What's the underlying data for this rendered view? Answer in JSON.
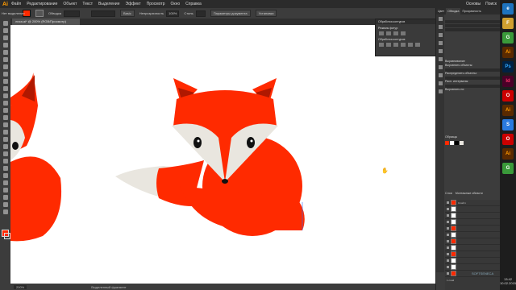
{
  "app": {
    "logo": "Ai"
  },
  "menu": [
    "Файл",
    "Редактирование",
    "Объект",
    "Текст",
    "Выделение",
    "Эффект",
    "Просмотр",
    "Окно",
    "Справка"
  ],
  "window_right": [
    "Основы",
    "Поиск"
  ],
  "control_bar": {
    "label_left": "Нет выделения",
    "stroke_label": "Обводка",
    "opacity_label": "Непрозрачность",
    "opacity_value": "100%",
    "style_label": "Стиль",
    "brush": "Basic",
    "doc_settings_btn": "Параметры документа",
    "prefs_btn": "Установки",
    "fill_color": "#ff2a00"
  },
  "doc_tab": {
    "title": "лиса.ai* @ 200% (RGB/Просмотр)"
  },
  "float_panel": {
    "title": "Обработка контуров",
    "shape_modes": "Режимы фигур:",
    "pathfinder": "Обработка контуров:"
  },
  "right_panel": {
    "tabs": [
      "Цвет",
      "Обводка",
      "Прозрачность"
    ],
    "align_tab": "Выравнивание",
    "align_objects": "Выровнять объекты:",
    "distribute": "Распределить объекты:",
    "distribute_spacing": "Расп. интервалы:",
    "align_to": "Выровнять по:",
    "swatches_tab": "Образцы",
    "layers_tab": "Слои",
    "artboards_tab": "Монтажные области",
    "layer_name": "Слой 1",
    "layers_count": "1 слой"
  },
  "status": {
    "zoom": "200%",
    "tool": "Выделенный фрагмент"
  },
  "taskbar": {
    "time": "13:42",
    "date": "10.02.2015",
    "apps": [
      "e",
      "F",
      "G",
      "Ai",
      "Ps",
      "Id",
      "O",
      "Ai",
      "S",
      "O",
      "Ai",
      "G"
    ]
  },
  "watermark": "SOFTSENECA",
  "colors": {
    "fox": "#ff2a00",
    "dark": "#b01800",
    "cream": "#e9e6df",
    "canvas": "#ffffff"
  }
}
